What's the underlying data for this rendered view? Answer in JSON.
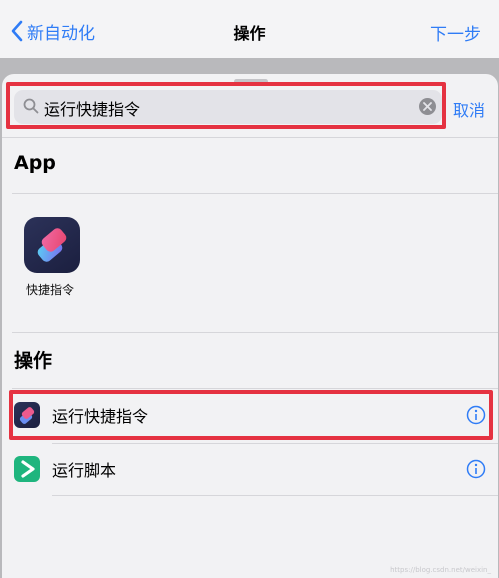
{
  "navbar": {
    "back_label": "新自动化",
    "title": "操作",
    "next_label": "下一步"
  },
  "search": {
    "value": "运行快捷指令",
    "cancel_label": "取消"
  },
  "sections": {
    "apps_header": "App",
    "actions_header": "操作"
  },
  "apps": [
    {
      "label": "快捷指令",
      "icon": "shortcuts-app-icon"
    }
  ],
  "actions": [
    {
      "label": "运行快捷指令",
      "icon": "shortcuts-icon"
    },
    {
      "label": "运行脚本",
      "icon": "run-script-icon"
    }
  ],
  "watermark": "https://blog.csdn.net/weixin_",
  "colors": {
    "accent": "#2f7cf6",
    "highlight": "#e53241"
  }
}
